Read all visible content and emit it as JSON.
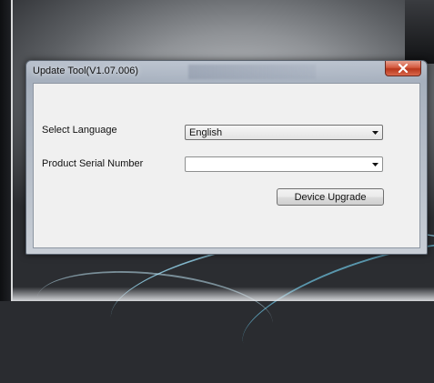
{
  "dialog": {
    "title": "Update Tool(V1.07.006)",
    "fields": [
      {
        "label": "Select Language",
        "value": "English"
      },
      {
        "label": "Product Serial Number",
        "value": ""
      }
    ],
    "upgrade_button": "Device Upgrade"
  },
  "icons": {
    "close": "close-icon",
    "dropdown": "chevron-down-icon"
  },
  "colors": {
    "close_button": "#c8412a",
    "client_background": "#f0f0f0"
  }
}
